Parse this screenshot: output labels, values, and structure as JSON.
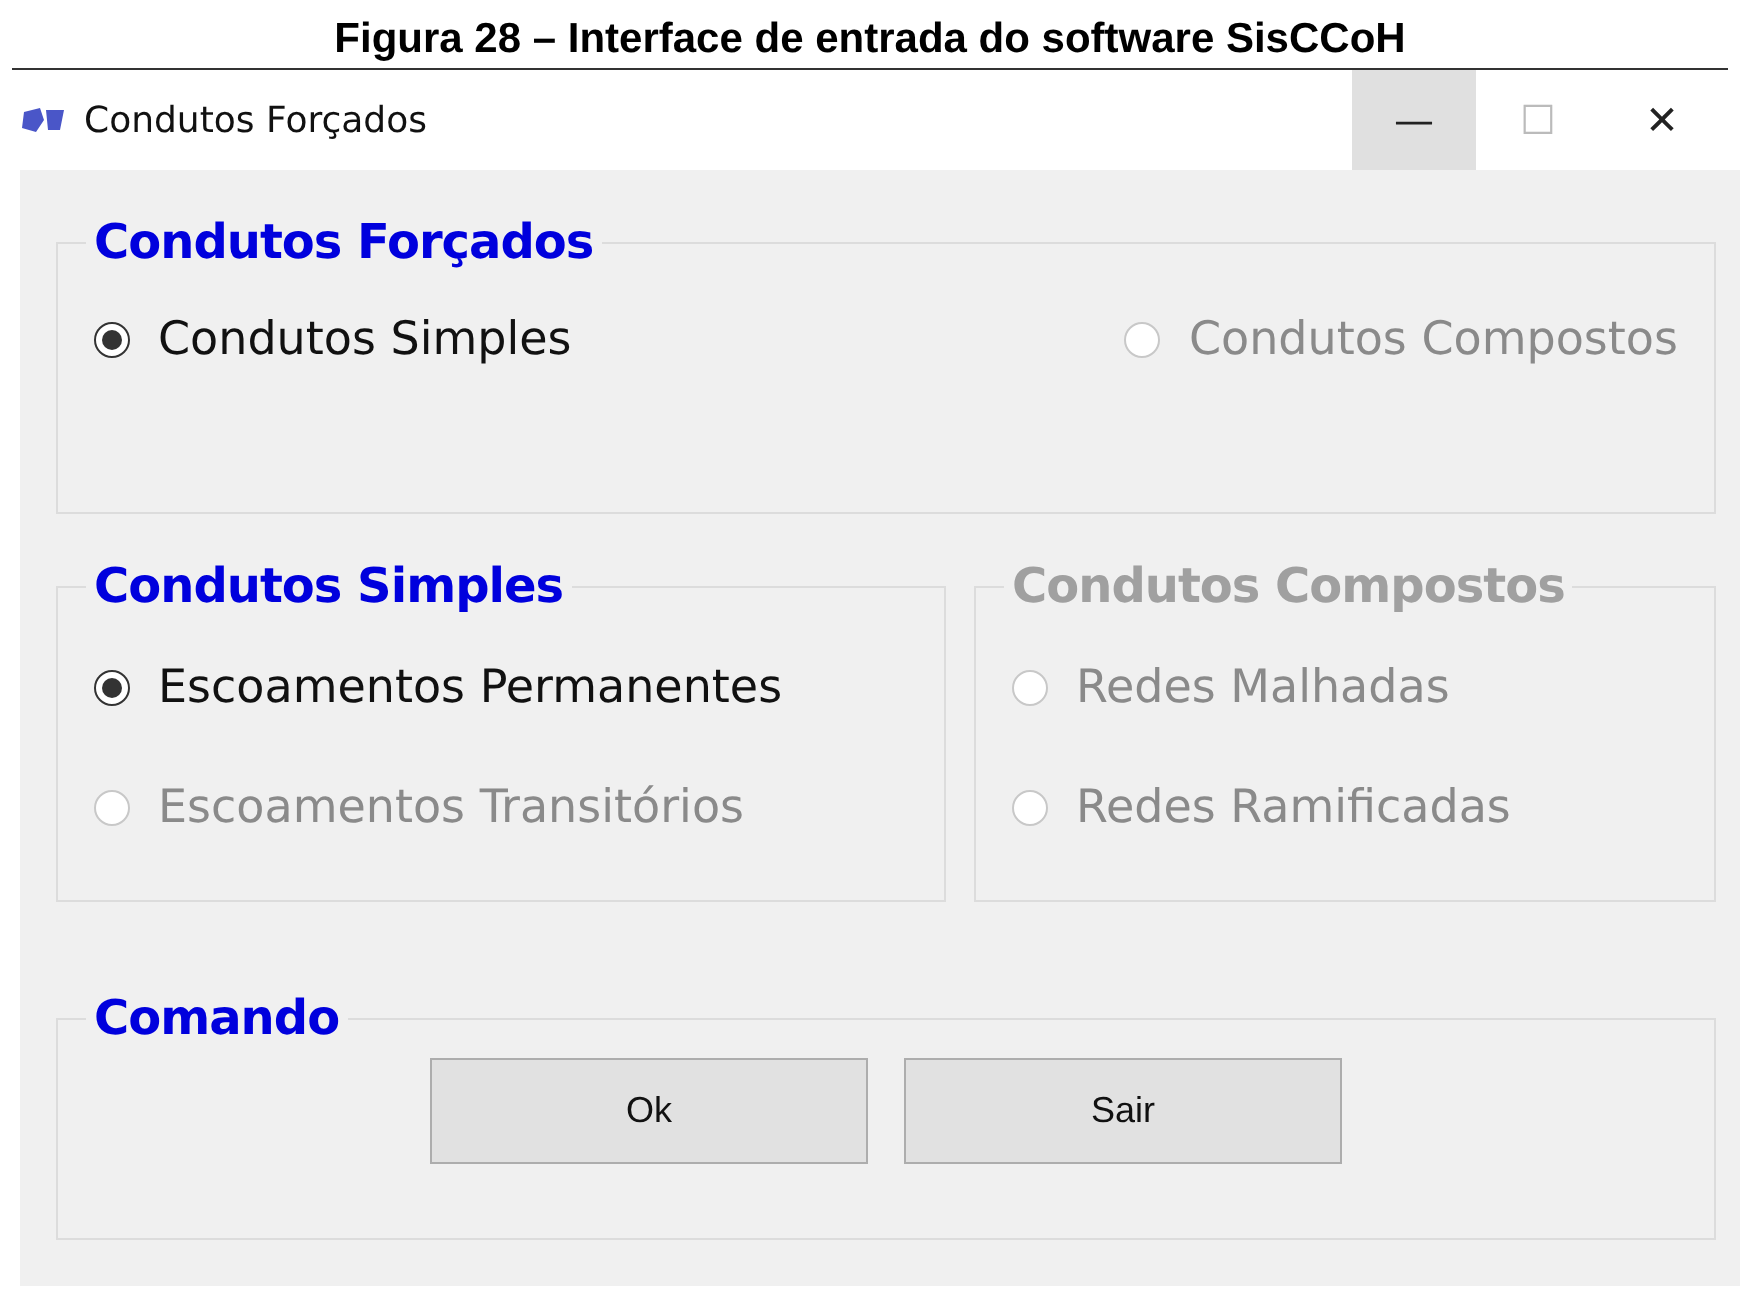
{
  "caption": "Figura 28 – Interface de entrada do software SisCCoH",
  "window": {
    "title": "Condutos Forçados",
    "controls": [
      "—",
      "☐",
      "✕"
    ]
  },
  "groups": [
    {
      "title": "Condutos Forçados",
      "disabled": false,
      "kind": "row",
      "options": [
        {
          "label": "Condutos Simples",
          "selected": true,
          "disabled": false
        },
        {
          "label": "Condutos Compostos",
          "selected": false,
          "disabled": true
        }
      ]
    },
    {
      "title": "Condutos Simples",
      "disabled": false,
      "kind": "column",
      "options": [
        {
          "label": "Escoamentos Permanentes",
          "selected": true,
          "disabled": false
        },
        {
          "label": "Escoamentos Transitórios",
          "selected": false,
          "disabled": true
        }
      ]
    },
    {
      "title": "Condutos Compostos",
      "disabled": true,
      "kind": "column",
      "options": [
        {
          "label": "Redes Malhadas",
          "selected": false,
          "disabled": true
        },
        {
          "label": "Redes Ramificadas",
          "selected": false,
          "disabled": true
        }
      ]
    }
  ],
  "command": {
    "title": "Comando",
    "buttons": [
      "Ok",
      "Sair"
    ]
  }
}
